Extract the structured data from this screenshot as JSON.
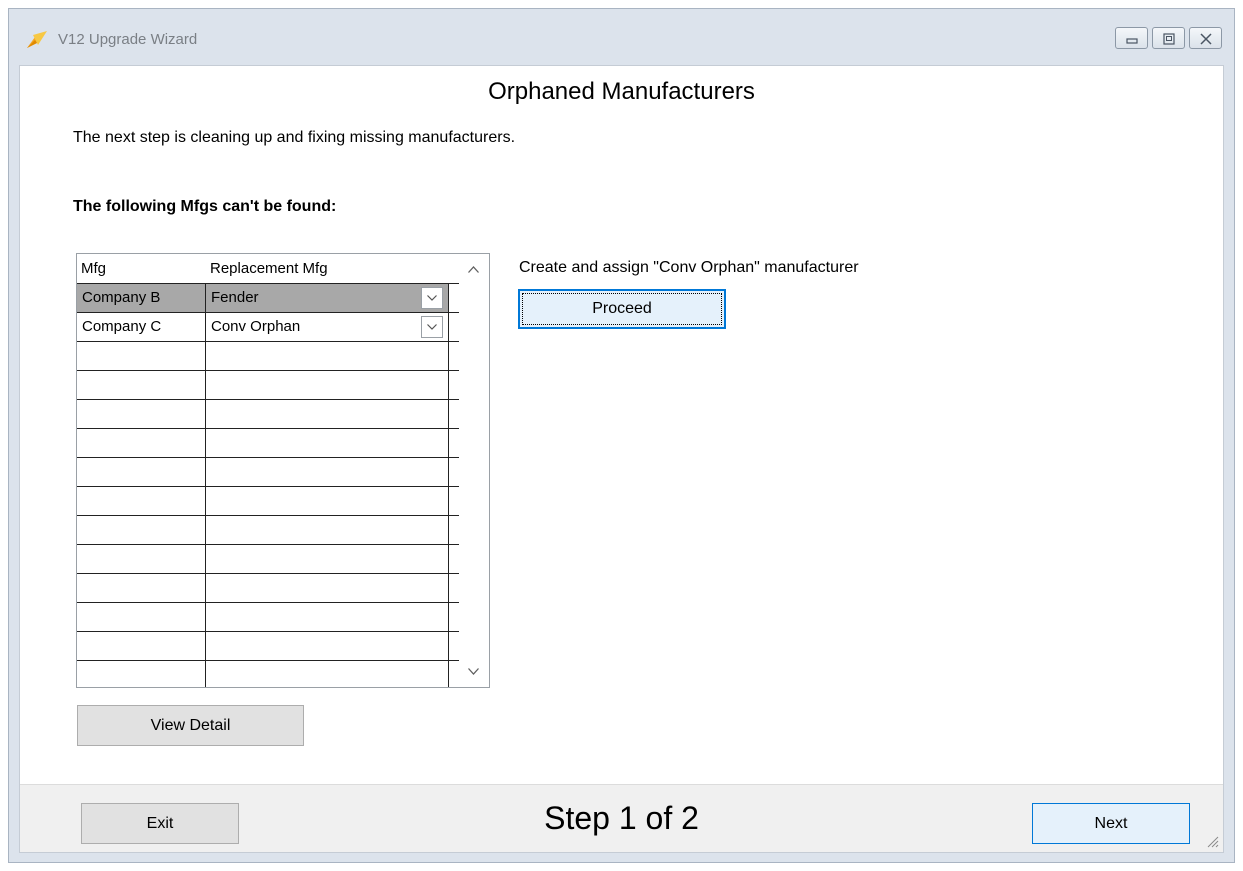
{
  "window": {
    "title": "V12 Upgrade Wizard",
    "icon": "app-logo-icon"
  },
  "page": {
    "title": "Orphaned Manufacturers",
    "intro": "The next step is cleaning up and fixing missing manufacturers.",
    "section_label": "The following Mfgs can't be found:"
  },
  "grid": {
    "columns": [
      "Mfg",
      "Replacement Mfg"
    ],
    "rows": [
      {
        "mfg": "Company B",
        "replacement": "Fender"
      },
      {
        "mfg": "Company C",
        "replacement": "Conv Orphan"
      }
    ],
    "view_detail_label": "View Detail"
  },
  "orphan_action": {
    "label": "Create and assign \"Conv Orphan\" manufacturer",
    "button_label": "Proceed"
  },
  "footer": {
    "exit_label": "Exit",
    "step_text": "Step 1 of 2",
    "next_label": "Next"
  },
  "colors": {
    "accent": "#0078d7",
    "selected_row": "#a8a8a8",
    "window_frame": "#dce3ec"
  }
}
